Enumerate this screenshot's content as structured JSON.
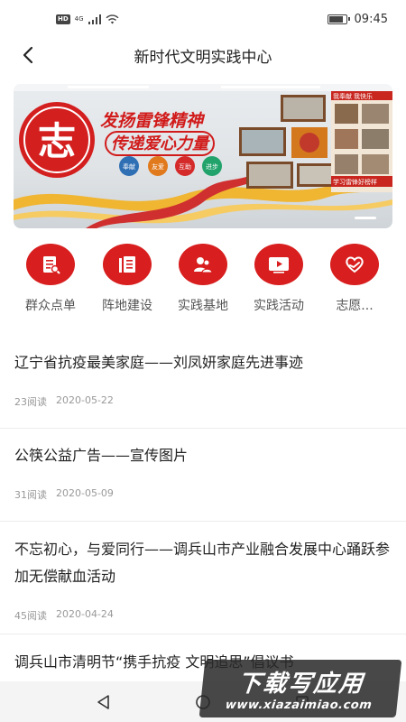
{
  "status_bar": {
    "hd": "HD",
    "network": "4G",
    "time": "09:45",
    "battery_level": 0.85
  },
  "nav": {
    "title": "新时代文明实践中心"
  },
  "banner": {
    "headline1": "发扬雷锋精神",
    "headline2": "传递爱心力量",
    "badges": [
      "奉献",
      "友爱",
      "互助",
      "进步"
    ],
    "logo_char": "志",
    "board_top": "我奉献 我快乐",
    "board_bottom": "学习雷锋好榜样"
  },
  "quick_nav": [
    {
      "label": "群众点单",
      "icon": "order-list-icon"
    },
    {
      "label": "阵地建设",
      "icon": "document-icon"
    },
    {
      "label": "实践基地",
      "icon": "people-icon"
    },
    {
      "label": "实践活动",
      "icon": "video-icon"
    },
    {
      "label": "志愿...",
      "icon": "heart-hand-icon"
    }
  ],
  "articles": [
    {
      "title": "辽宁省抗疫最美家庭——刘凤妍家庭先进事迹",
      "reads": "23阅读",
      "date": "2020-05-22"
    },
    {
      "title": "公筷公益广告——宣传图片",
      "reads": "31阅读",
      "date": "2020-05-09"
    },
    {
      "title": "不忘初心，与爱同行——调兵山市产业融合发展中心踊跃参加无偿献血活动",
      "reads": "45阅读",
      "date": "2020-04-24"
    },
    {
      "title": "调兵山市清明节“携手抗疫 文明追思”倡议书",
      "reads": "",
      "date": ""
    }
  ],
  "watermark": {
    "line1": "下载写应用",
    "line2": "www.xiazaimiao.com"
  },
  "colors": {
    "accent": "#d81e1e",
    "banner_bg": "#e3e6e9"
  }
}
